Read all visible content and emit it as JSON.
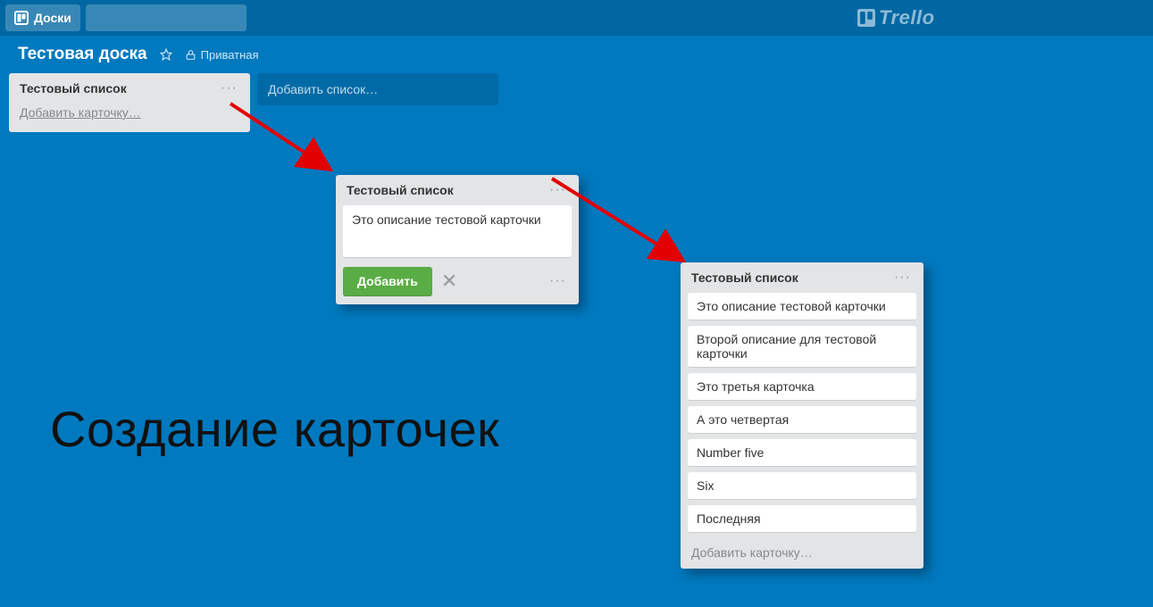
{
  "header": {
    "boards_label": "Доски",
    "search_placeholder": "",
    "logo_text": "Trello"
  },
  "board": {
    "name": "Тестовая доска",
    "privacy_label": "Приватная"
  },
  "list1": {
    "title": "Тестовый список",
    "add_card_label": "Добавить карточку…"
  },
  "add_list_label": "Добавить список…",
  "list2": {
    "title": "Тестовый список",
    "compose_text": "Это описание тестовой карточки",
    "add_button": "Добавить"
  },
  "list3": {
    "title": "Тестовый список",
    "cards": [
      "Это описание тестовой карточки",
      "Второй описание для тестовой карточки",
      "Это третья карточка",
      "А это четвертая",
      "Number five",
      "Six",
      "Последняя"
    ],
    "add_card_label": "Добавить карточку…"
  },
  "caption": "Создание карточек"
}
